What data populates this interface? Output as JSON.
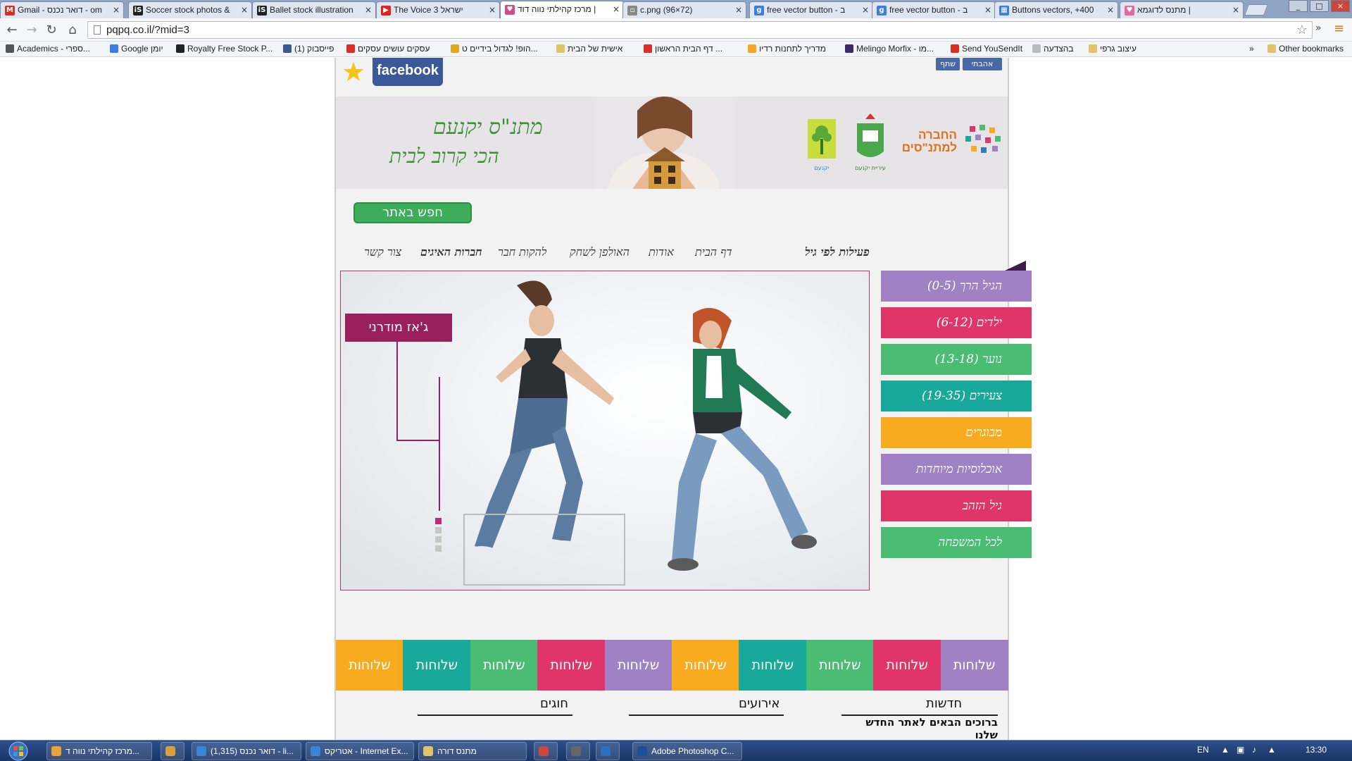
{
  "browser": {
    "tabs": [
      {
        "label": "Gmail - דואר נכנס - om",
        "favicon": "gmail-icon",
        "active": false
      },
      {
        "label": "Soccer stock photos &",
        "favicon": "istock-icon",
        "active": false
      },
      {
        "label": "Ballet stock illustration",
        "favicon": "istock-icon",
        "active": false
      },
      {
        "label": "The Voice 3 ישראל",
        "favicon": "youtube-icon",
        "active": false
      },
      {
        "label": "מרכז קהילתי נווה דוד |",
        "favicon": "site-icon",
        "active": true
      },
      {
        "label": "c.png (96×72)",
        "favicon": "page-icon",
        "active": false
      },
      {
        "label": "free vector button - ב",
        "favicon": "google-icon",
        "active": false
      },
      {
        "label": "free vector button - ב",
        "favicon": "google-icon",
        "active": false
      },
      {
        "label": "Buttons vectors, +400",
        "favicon": "vector-site-icon",
        "active": false
      },
      {
        "label": "מתנס לדוגמא |",
        "favicon": "heart-icon",
        "active": false
      }
    ],
    "url": "pqpq.co.il/?mid=3",
    "bookmarks": [
      "Academics - ספרי...",
      "Google יומן",
      "Royalty Free Stock P...",
      "פייסבוק (1)",
      "עסקים עושים עסקים",
      "הופ! לגדול בידיים ט...",
      "אישית של הבית",
      "דף הבית הראשון ...",
      "מדריך לתחנות רדיו",
      "Melingo Morfix - מו...",
      "Send YouSendIt",
      "בהצדעה",
      "עיצוב גרפי",
      "Other bookmarks"
    ],
    "bookmarks_overflow": "»"
  },
  "site": {
    "facebook": {
      "logo_text": "facebook",
      "like_label": "אהבתי",
      "share_label": "שתף"
    },
    "banner": {
      "slogan_line1": "מתנ\"ס יקנעם",
      "slogan_line2": "הכי קרוב לבית",
      "org_name": "החברה למתנ\"סים",
      "city_label": "עיריית יקנעם",
      "yokneam_label": "יקנעם"
    },
    "search_button": "חפש באתר",
    "nav": {
      "by_age": "פעילות לפי גיל",
      "items": [
        "דף הבית",
        "אודות",
        "האולפן לשחק",
        "להקות חבר",
        "חברות האיגים",
        "צור קשר"
      ]
    },
    "hero": {
      "label": "ג'אז מודרני"
    },
    "categories": [
      {
        "label": "הגיל הרך (0-5)",
        "color": "#a082c4"
      },
      {
        "label": "ילדים (6-12)",
        "color": "#e0356b"
      },
      {
        "label": "נוער (13-18)",
        "color": "#4bbc73"
      },
      {
        "label": "צעירים (19-35)",
        "color": "#19a99b"
      },
      {
        "label": "מבוגרים",
        "color": "#f8ab1e"
      },
      {
        "label": "אוכלוסיות מיוחדות",
        "color": "#a082c4"
      },
      {
        "label": "גיל הזהב",
        "color": "#e0356b"
      },
      {
        "label": "לכל המשפחה",
        "color": "#4bbc73"
      }
    ],
    "tiles": [
      {
        "label": "שלוחות",
        "color": "#f8ab1e"
      },
      {
        "label": "שלוחות",
        "color": "#19a99b"
      },
      {
        "label": "שלוחות",
        "color": "#4bbc73"
      },
      {
        "label": "שלוחות",
        "color": "#e0356b"
      },
      {
        "label": "שלוחות",
        "color": "#a082c4"
      },
      {
        "label": "שלוחות",
        "color": "#f8ab1e"
      },
      {
        "label": "שלוחות",
        "color": "#19a99b"
      },
      {
        "label": "שלוחות",
        "color": "#4bbc73"
      },
      {
        "label": "שלוחות",
        "color": "#e0356b"
      },
      {
        "label": "שלוחות",
        "color": "#a082c4"
      }
    ],
    "sections": {
      "news": "חדשות",
      "events": "אירועים",
      "clubs": "חוגים",
      "news_text": "ברוכים הבאים לאתר החדש שלנו"
    }
  },
  "taskbar": {
    "tasks": [
      "מרכז קהילתי נווה ד...",
      "",
      "דואר נכנס (1,315) - li...",
      "אטריקס - Internet Ex...",
      "מתנס דורה",
      "",
      "",
      "",
      "Adobe Photoshop C..."
    ],
    "language": "EN",
    "clock": "13:30"
  }
}
